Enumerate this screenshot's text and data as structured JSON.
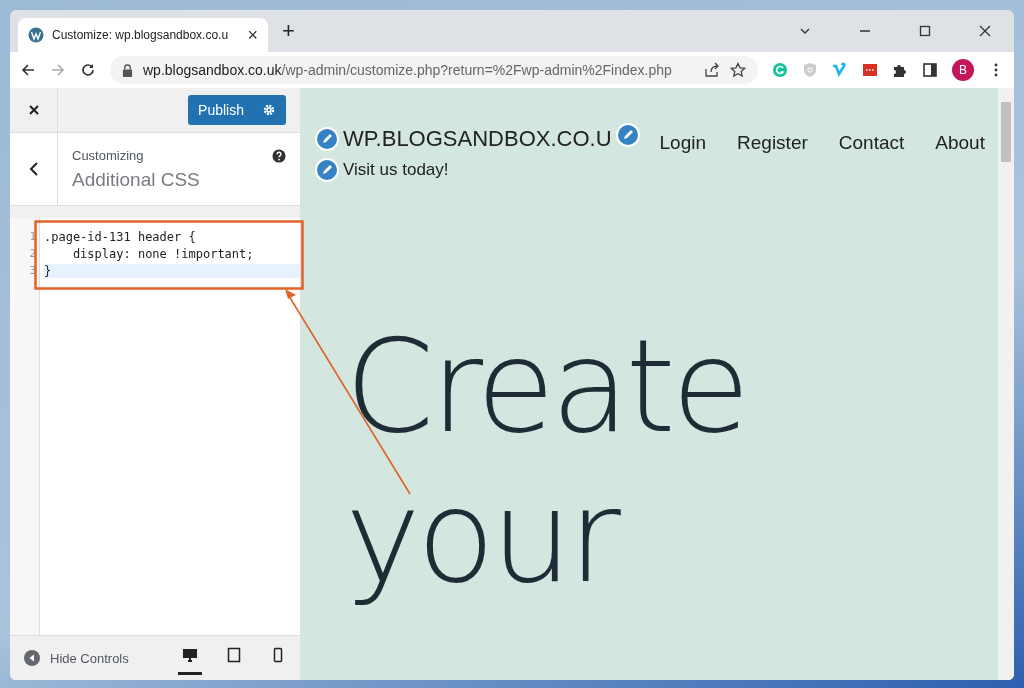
{
  "browser": {
    "tab": {
      "title": "Customize: wp.blogsandbox.co.u",
      "close": "×"
    },
    "new_tab": "+",
    "url": {
      "host": "wp.blogsandbox.co.uk",
      "path": "/wp-admin/customize.php?return=%2Fwp-admin%2Findex.php"
    },
    "profile": "B"
  },
  "customizer": {
    "publish": "Publish",
    "section_label": "Customizing",
    "section_title": "Additional CSS",
    "code_lines": [
      {
        "number": "1",
        "text": ".page-id-131 header {",
        "selected": false
      },
      {
        "number": "2",
        "text": "    display: none !important;",
        "selected": false
      },
      {
        "number": "3",
        "text": "}",
        "selected": true
      }
    ],
    "hide_controls": "Hide Controls",
    "devices": [
      {
        "kind": "desktop",
        "selected": true
      },
      {
        "kind": "tablet",
        "selected": false
      },
      {
        "kind": "mobile",
        "selected": false
      }
    ]
  },
  "preview": {
    "site_title": "WP.BLOGSANDBOX.CO.U",
    "tagline": "Visit us today!",
    "nav": [
      "Login",
      "Register",
      "Contact",
      "About"
    ],
    "hero": [
      "Create",
      "your"
    ]
  }
}
